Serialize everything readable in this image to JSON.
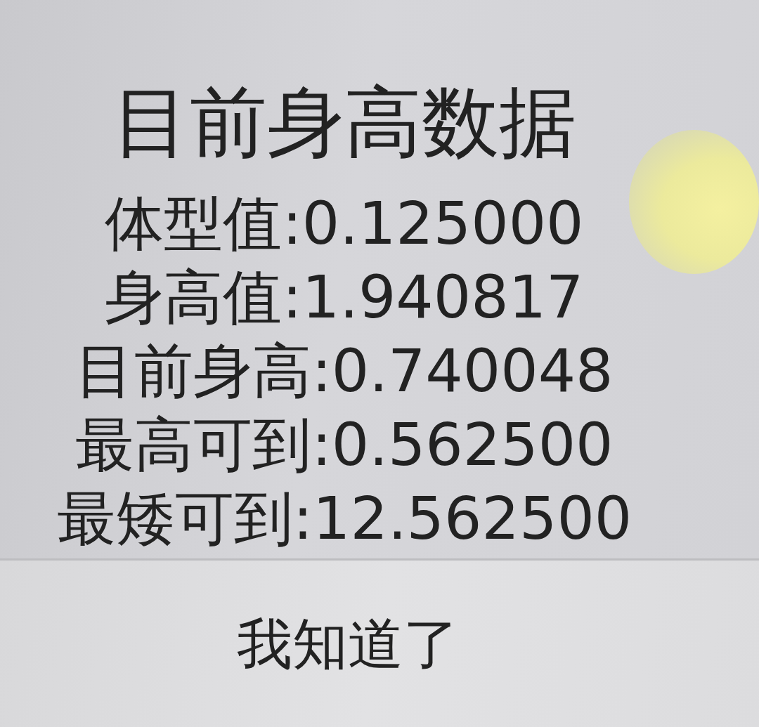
{
  "dialog": {
    "title": "目前身高数据",
    "lines": [
      "体型值:0.125000",
      "身高值:1.940817",
      "目前身高:0.740048",
      "最高可到:0.562500",
      "最矮可到:12.562500"
    ],
    "button": "我知道了"
  }
}
